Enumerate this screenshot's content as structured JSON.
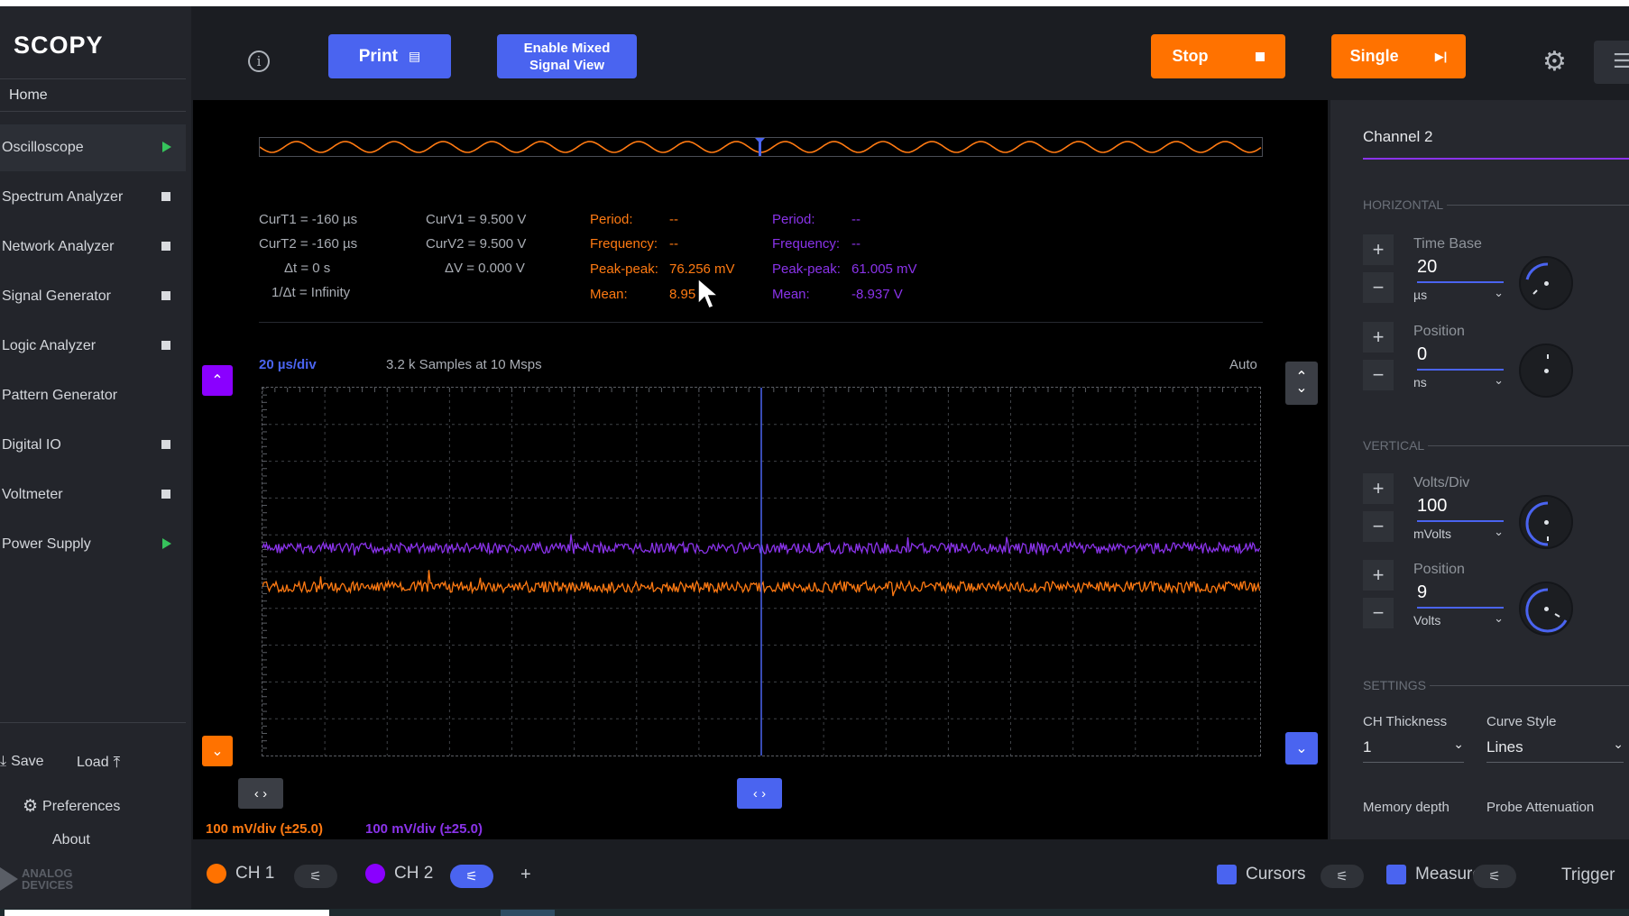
{
  "app": {
    "logo": "SCOPY",
    "home": "Home"
  },
  "sidebar": {
    "items": [
      {
        "label": "Oscilloscope",
        "indicator": "play",
        "active": true
      },
      {
        "label": "Spectrum Analyzer",
        "indicator": "square"
      },
      {
        "label": "Network Analyzer",
        "indicator": "square"
      },
      {
        "label": "Signal Generator",
        "indicator": "square"
      },
      {
        "label": "Logic Analyzer",
        "indicator": "square"
      },
      {
        "label": "Pattern Generator",
        "indicator": "none"
      },
      {
        "label": "Digital IO",
        "indicator": "square"
      },
      {
        "label": "Voltmeter",
        "indicator": "square"
      },
      {
        "label": "Power Supply",
        "indicator": "play"
      }
    ],
    "save": "Save",
    "load": "Load",
    "preferences": "Preferences",
    "about": "About",
    "vendor_line1": "ANALOG",
    "vendor_line2": "DEVICES"
  },
  "toolbar": {
    "print": "Print",
    "mixed_line1": "Enable Mixed",
    "mixed_line2": "Signal View",
    "stop": "Stop",
    "single": "Single"
  },
  "measurements": {
    "curt1": "CurT1 = -160 µs",
    "curt2": "CurT2 = -160 µs",
    "dt": "Δt = 0 s",
    "inv_dt": "1/Δt = Infinity",
    "curv1": "CurV1 = 9.500 V",
    "curv2": "CurV2 = 9.500 V",
    "dv": "ΔV = 0.000 V",
    "ch1": {
      "period_label": "Period:",
      "period": "--",
      "freq_label": "Frequency:",
      "freq": "--",
      "pp_label": "Peak-peak:",
      "pp": "76.256 mV",
      "mean_label": "Mean:",
      "mean": "8.95"
    },
    "ch2": {
      "period_label": "Period:",
      "period": "--",
      "freq_label": "Frequency:",
      "freq": "--",
      "pp_label": "Peak-peak:",
      "pp": "61.005 mV",
      "mean_label": "Mean:",
      "mean": "-8.937 V"
    }
  },
  "plot": {
    "timebase": "20 µs/div",
    "samples": "3.2 k Samples at 10 Msps",
    "mode": "Auto",
    "ch1_scale": "100 mV/div (±25.0)",
    "ch2_scale": "100 mV/div (±25.0)"
  },
  "panel": {
    "title": "Channel 2",
    "horizontal": "HORIZONTAL",
    "vertical": "VERTICAL",
    "settings": "SETTINGS",
    "timebase": {
      "label": "Time Base",
      "value": "20",
      "unit": "µs"
    },
    "hposition": {
      "label": "Position",
      "value": "0",
      "unit": "ns"
    },
    "voltsdiv": {
      "label": "Volts/Div",
      "value": "100",
      "unit": "mVolts"
    },
    "vposition": {
      "label": "Position",
      "value": "9",
      "unit": "Volts"
    },
    "thickness": {
      "label": "CH Thickness",
      "value": "1"
    },
    "curve": {
      "label": "Curve Style",
      "value": "Lines"
    },
    "memory": {
      "label": "Memory depth"
    },
    "probe": {
      "label": "Probe Attenuation"
    }
  },
  "bottom": {
    "ch1": "CH 1",
    "ch2": "CH 2",
    "add": "+",
    "cursors": "Cursors",
    "measure": "Measure",
    "trigger": "Trigger"
  },
  "colors": {
    "ch1": "#ff7a12",
    "ch2": "#8a33ea",
    "accent": "#4a64f0",
    "action": "#ff7200"
  }
}
